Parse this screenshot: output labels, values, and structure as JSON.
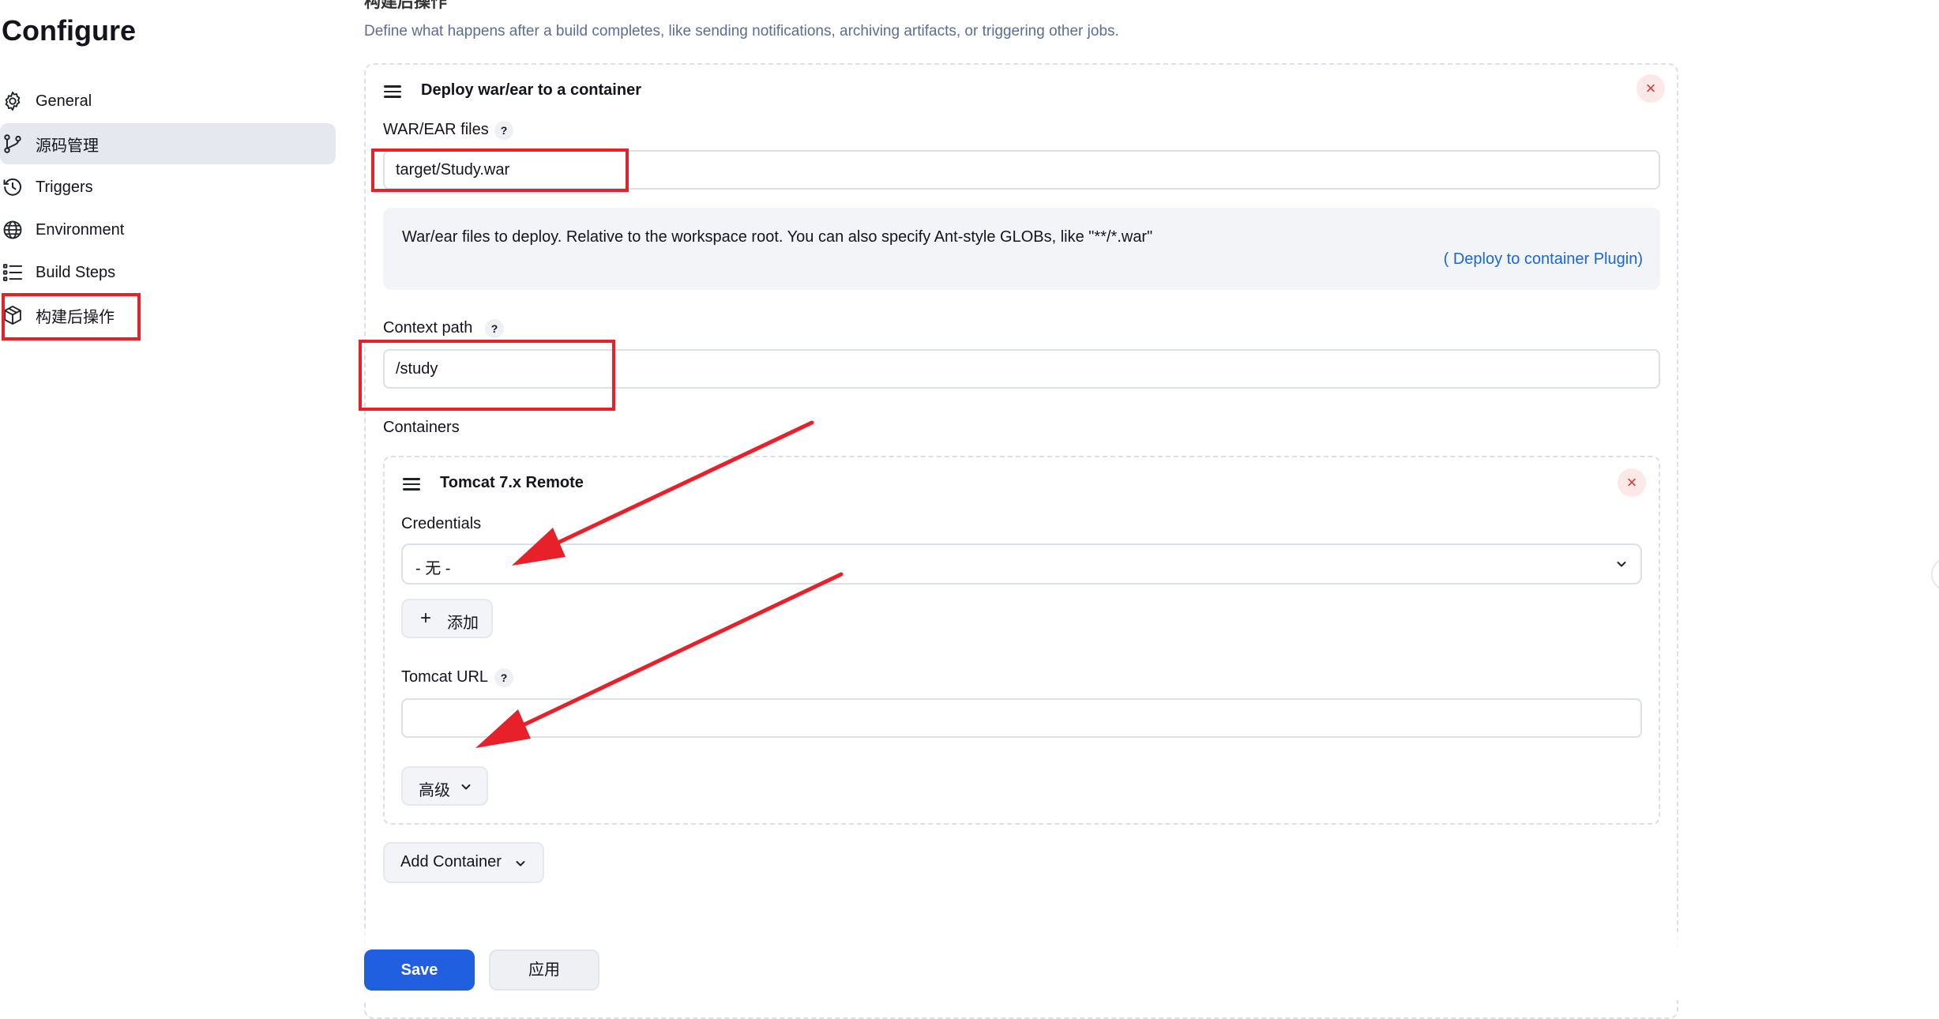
{
  "sidebar": {
    "title": "Configure",
    "items": [
      {
        "label": "General",
        "icon": "gear-icon"
      },
      {
        "label": "源码管理",
        "icon": "branch-icon"
      },
      {
        "label": "Triggers",
        "icon": "clock-icon"
      },
      {
        "label": "Environment",
        "icon": "globe-icon"
      },
      {
        "label": "Build Steps",
        "icon": "list-icon"
      },
      {
        "label": "构建后操作",
        "icon": "package-icon"
      }
    ],
    "active_index": 1
  },
  "section": {
    "heading": "构建后操作",
    "description": "Define what happens after a build completes, like sending notifications, archiving artifacts, or triggering other jobs."
  },
  "deploy_card": {
    "title": "Deploy war/ear to a container",
    "close": "×",
    "war_files": {
      "label": "WAR/EAR files",
      "help": "?",
      "value": "target/Study.war",
      "help_text": "War/ear files to deploy. Relative to the workspace root. You can also specify Ant-style GLOBs, like \"**/*.war\"",
      "link_open": "(",
      "link_label": " Deploy to container Plugin",
      "link_close": ")"
    },
    "context_path": {
      "label": "Context path",
      "help": "?",
      "value": "/study"
    },
    "containers_label": "Containers",
    "container": {
      "title": "Tomcat 7.x Remote",
      "close": "×",
      "credentials": {
        "label": "Credentials",
        "selected": "- 无 -"
      },
      "add_button": {
        "icon": "+",
        "label": "添加"
      },
      "tomcat_url": {
        "label": "Tomcat URL",
        "help": "?",
        "value": ""
      },
      "advanced_label": "高级"
    },
    "add_container_label": "Add Container"
  },
  "footer": {
    "save_label": "Save",
    "apply_label": "应用"
  },
  "colors": {
    "primary": "#1f5fe0",
    "link": "#1a66d6",
    "annotation": "#e8202a",
    "active_nav": "#e6e8ef"
  }
}
